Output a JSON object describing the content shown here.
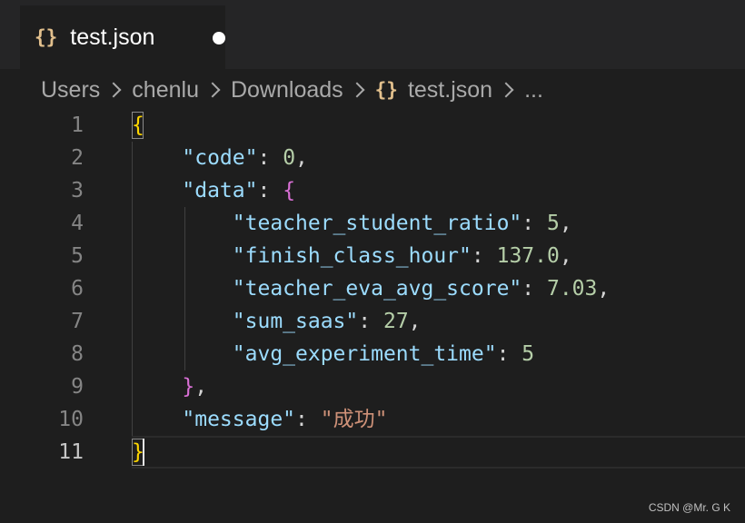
{
  "tab": {
    "icon": "{}",
    "label": "test.json",
    "status": "unsaved"
  },
  "breadcrumb": {
    "items": [
      "Users",
      "chenlu",
      "Downloads"
    ],
    "file_icon": "{}",
    "file": "test.json",
    "more": "..."
  },
  "editor": {
    "current_line": 11,
    "lines": [
      {
        "number": "1",
        "tokens": [
          {
            "t": "{",
            "c": "brace-y"
          }
        ]
      },
      {
        "number": "2",
        "tokens": [
          {
            "t": "    "
          },
          {
            "t": "\"code\"",
            "c": "key"
          },
          {
            "t": ": ",
            "c": "punct"
          },
          {
            "t": "0",
            "c": "num"
          },
          {
            "t": ",",
            "c": "punct"
          }
        ]
      },
      {
        "number": "3",
        "tokens": [
          {
            "t": "    "
          },
          {
            "t": "\"data\"",
            "c": "key"
          },
          {
            "t": ": ",
            "c": "punct"
          },
          {
            "t": "{",
            "c": "brace-p"
          }
        ]
      },
      {
        "number": "4",
        "tokens": [
          {
            "t": "        "
          },
          {
            "t": "\"teacher_student_ratio\"",
            "c": "key"
          },
          {
            "t": ": ",
            "c": "punct"
          },
          {
            "t": "5",
            "c": "num"
          },
          {
            "t": ",",
            "c": "punct"
          }
        ]
      },
      {
        "number": "5",
        "tokens": [
          {
            "t": "        "
          },
          {
            "t": "\"finish_class_hour\"",
            "c": "key"
          },
          {
            "t": ": ",
            "c": "punct"
          },
          {
            "t": "137.0",
            "c": "num"
          },
          {
            "t": ",",
            "c": "punct"
          }
        ]
      },
      {
        "number": "6",
        "tokens": [
          {
            "t": "        "
          },
          {
            "t": "\"teacher_eva_avg_score\"",
            "c": "key"
          },
          {
            "t": ": ",
            "c": "punct"
          },
          {
            "t": "7.03",
            "c": "num"
          },
          {
            "t": ",",
            "c": "punct"
          }
        ]
      },
      {
        "number": "7",
        "tokens": [
          {
            "t": "        "
          },
          {
            "t": "\"sum_saas\"",
            "c": "key"
          },
          {
            "t": ": ",
            "c": "punct"
          },
          {
            "t": "27",
            "c": "num"
          },
          {
            "t": ",",
            "c": "punct"
          }
        ]
      },
      {
        "number": "8",
        "tokens": [
          {
            "t": "        "
          },
          {
            "t": "\"avg_experiment_time\"",
            "c": "key"
          },
          {
            "t": ": ",
            "c": "punct"
          },
          {
            "t": "5",
            "c": "num"
          }
        ]
      },
      {
        "number": "9",
        "tokens": [
          {
            "t": "    "
          },
          {
            "t": "}",
            "c": "brace-p"
          },
          {
            "t": ",",
            "c": "punct"
          }
        ]
      },
      {
        "number": "10",
        "tokens": [
          {
            "t": "    "
          },
          {
            "t": "\"message\"",
            "c": "key"
          },
          {
            "t": ": ",
            "c": "punct"
          },
          {
            "t": "\"成功\"",
            "c": "str"
          }
        ]
      },
      {
        "number": "11",
        "tokens": [
          {
            "t": "}",
            "c": "brace-y"
          }
        ]
      }
    ]
  },
  "watermark": "CSDN @Mr. G K",
  "colors": {
    "background": "#1e1e1e",
    "key": "#9cdcfe",
    "number": "#b5cea8",
    "string": "#ce9178",
    "brace_outer": "#ffd700",
    "brace_inner": "#da70d6"
  }
}
